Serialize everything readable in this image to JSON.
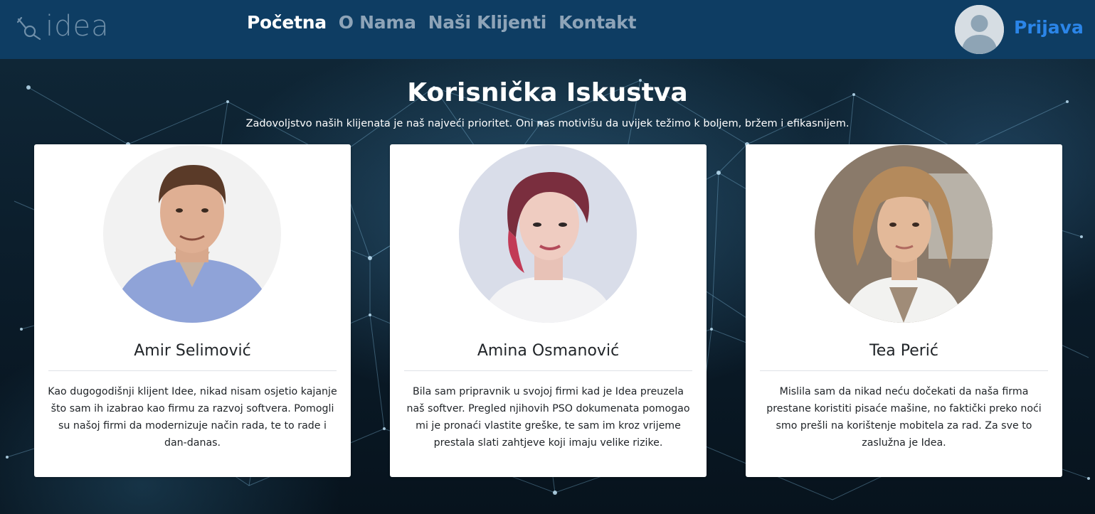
{
  "navbar": {
    "logo_text": "idea",
    "links": [
      {
        "label": "Početna",
        "active": true
      },
      {
        "label": "O Nama",
        "active": false
      },
      {
        "label": "Naši Klijenti",
        "active": false
      },
      {
        "label": "Kontakt",
        "active": false
      }
    ],
    "login_label": "Prijava"
  },
  "section": {
    "title": "Korisnička Iskustva",
    "subtitle": "Zadovoljstvo naših klijenata je naš najveći prioritet. Oni nas motivišu da uvijek težimo k boljem, bržem i efikasnijem."
  },
  "testimonials": [
    {
      "name": "Amir Selimović",
      "quote": "Kao dugogodišnji klijent Idee, nikad nisam osjetio kajanje što sam ih izabrao kao firmu za razvoj softvera. Pomogli su našoj firmi da modernizuje način rada, te to rade i dan-danas."
    },
    {
      "name": "Amina Osmanović",
      "quote": "Bila sam pripravnik u svojoj firmi kad je Idea preuzela naš softver. Pregled njihovih PSO dokumenata pomogao mi je pronaći vlastite greške, te sam im kroz vrijeme prestala slati zahtjeve koji imaju velike rizike."
    },
    {
      "name": "Tea Perić",
      "quote": "Mislila sam da nikad neću dočekati da naša firma prestane koristiti pisaće mašine, no faktički preko noći smo prešli na korištenje mobitela za rad. Za sve to zaslužna je Idea."
    }
  ],
  "colors": {
    "navbar": "#0e3d63",
    "nav_active": "#ffffff",
    "nav_inactive": "#8ea4b8",
    "login": "#2b85e8"
  }
}
